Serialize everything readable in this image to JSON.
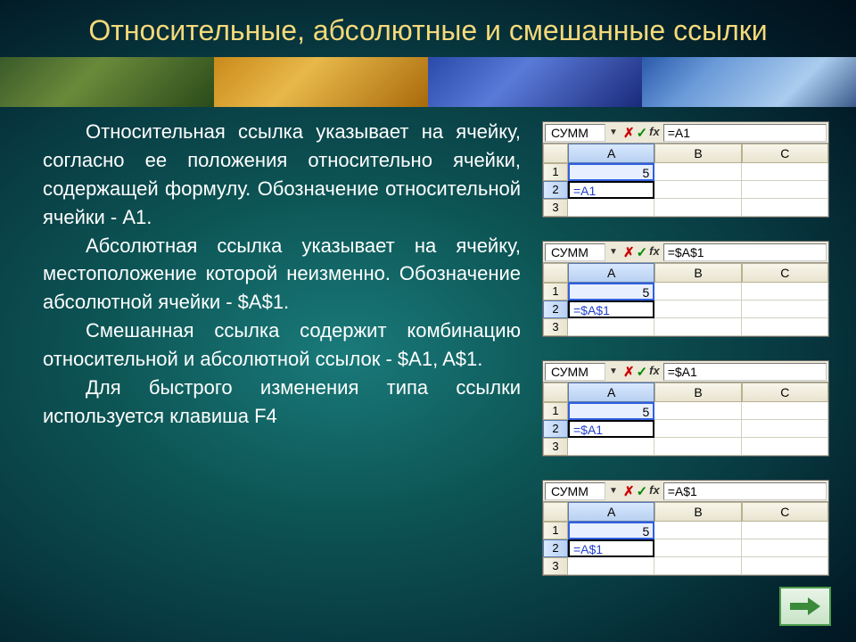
{
  "title": "Относительные, абсолютные и смешанные ссылки",
  "paragraphs": [
    "Относительная ссылка указывает на ячейку, согласно ее положения относительно ячейки, содержащей формулу. Обозначение относительной ячейки - A1.",
    "Абсолютная ссылка указывает на ячейку, местоположение которой неизменно. Обозначение абсолютной ячейки - $A$1.",
    "Смешанная ссылка содержит комбинацию относительной и абсолютной ссылок - $A1, A$1.",
    "Для быстрого изменения типа ссылки используется клавиша F4"
  ],
  "sheets": [
    {
      "name": "СУММ",
      "formula": "=A1",
      "a1": "5",
      "a2": "=A1"
    },
    {
      "name": "СУММ",
      "formula": "=$A$1",
      "a1": "5",
      "a2": "=$A$1"
    },
    {
      "name": "СУММ",
      "formula": "=$A1",
      "a1": "5",
      "a2": "=$A1"
    },
    {
      "name": "СУММ",
      "formula": "=A$1",
      "a1": "5",
      "a2": "=A$1"
    }
  ],
  "cols": [
    "A",
    "B",
    "C"
  ],
  "rows": [
    "1",
    "2",
    "3"
  ],
  "icons": {
    "cancel": "✗",
    "enter": "✓",
    "fx": "fx",
    "dropdown": "▼"
  }
}
